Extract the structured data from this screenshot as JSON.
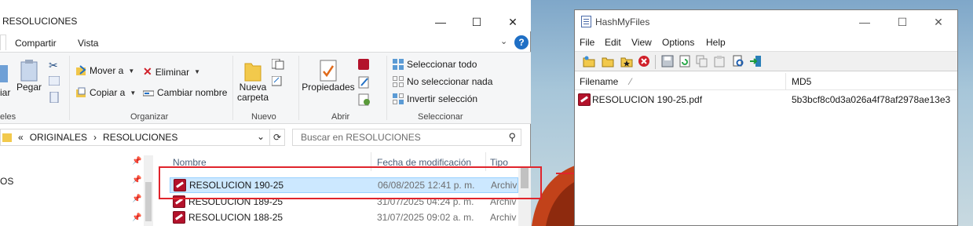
{
  "explorer": {
    "title": "RESOLUCIONES",
    "window_controls": {
      "minimize": "—",
      "maximize": "☐",
      "close": "✕"
    },
    "tabs": [
      "Compartir",
      "Vista"
    ],
    "help": "?",
    "ribbon": {
      "portapapeles": {
        "left_label": "eles",
        "pin_cut_label": "iar",
        "paste_label": "Pegar"
      },
      "organizar": {
        "label": "Organizar",
        "move_to": "Mover a",
        "copy_to": "Copiar a",
        "delete": "Eliminar",
        "rename": "Cambiar nombre"
      },
      "nuevo": {
        "label": "Nuevo",
        "new_folder": "Nueva carpeta"
      },
      "abrir": {
        "label": "Abrir",
        "properties": "Propiedades"
      },
      "seleccionar": {
        "label": "Seleccionar",
        "select_all": "Seleccionar todo",
        "select_none": "No seleccionar nada",
        "invert": "Invertir selección"
      }
    },
    "address": {
      "prefix": "«",
      "parts": [
        "ORIGINALES",
        "›",
        "RESOLUCIONES"
      ],
      "dropdown": "⌄",
      "refresh": "⟳"
    },
    "search_placeholder": "Buscar en RESOLUCIONES",
    "nav": {
      "visible_item": "OS"
    },
    "columns": {
      "name": "Nombre",
      "date": "Fecha de modificación",
      "type": "Tipo"
    },
    "files": [
      {
        "name": "RESOLUCION 190-25",
        "date": "06/08/2025 12:41 p. m.",
        "type": "Archiv",
        "selected": true
      },
      {
        "name": "RESOLUCION 189-25",
        "date": "31/07/2025 04:24 p. m.",
        "type": "Archiv",
        "selected": false
      },
      {
        "name": "RESOLUCION 188-25",
        "date": "31/07/2025 09:02 a. m.",
        "type": "Archiv",
        "selected": false
      }
    ]
  },
  "hashmyfiles": {
    "title": "HashMyFiles",
    "window_controls": {
      "minimize": "—",
      "maximize": "☐",
      "close": "✕"
    },
    "menu": [
      "File",
      "Edit",
      "View",
      "Options",
      "Help"
    ],
    "columns": {
      "filename": "Filename",
      "sort_indicator": "⁄",
      "md5": "MD5"
    },
    "rows": [
      {
        "filename": "RESOLUCION 190-25.pdf",
        "md5": "5b3bcf8c0d3a026a4f78af2978ae13e3"
      }
    ]
  },
  "colors": {
    "accent_red": "#e0242c",
    "selection": "#cce8ff",
    "pdf": "#b3122b"
  }
}
